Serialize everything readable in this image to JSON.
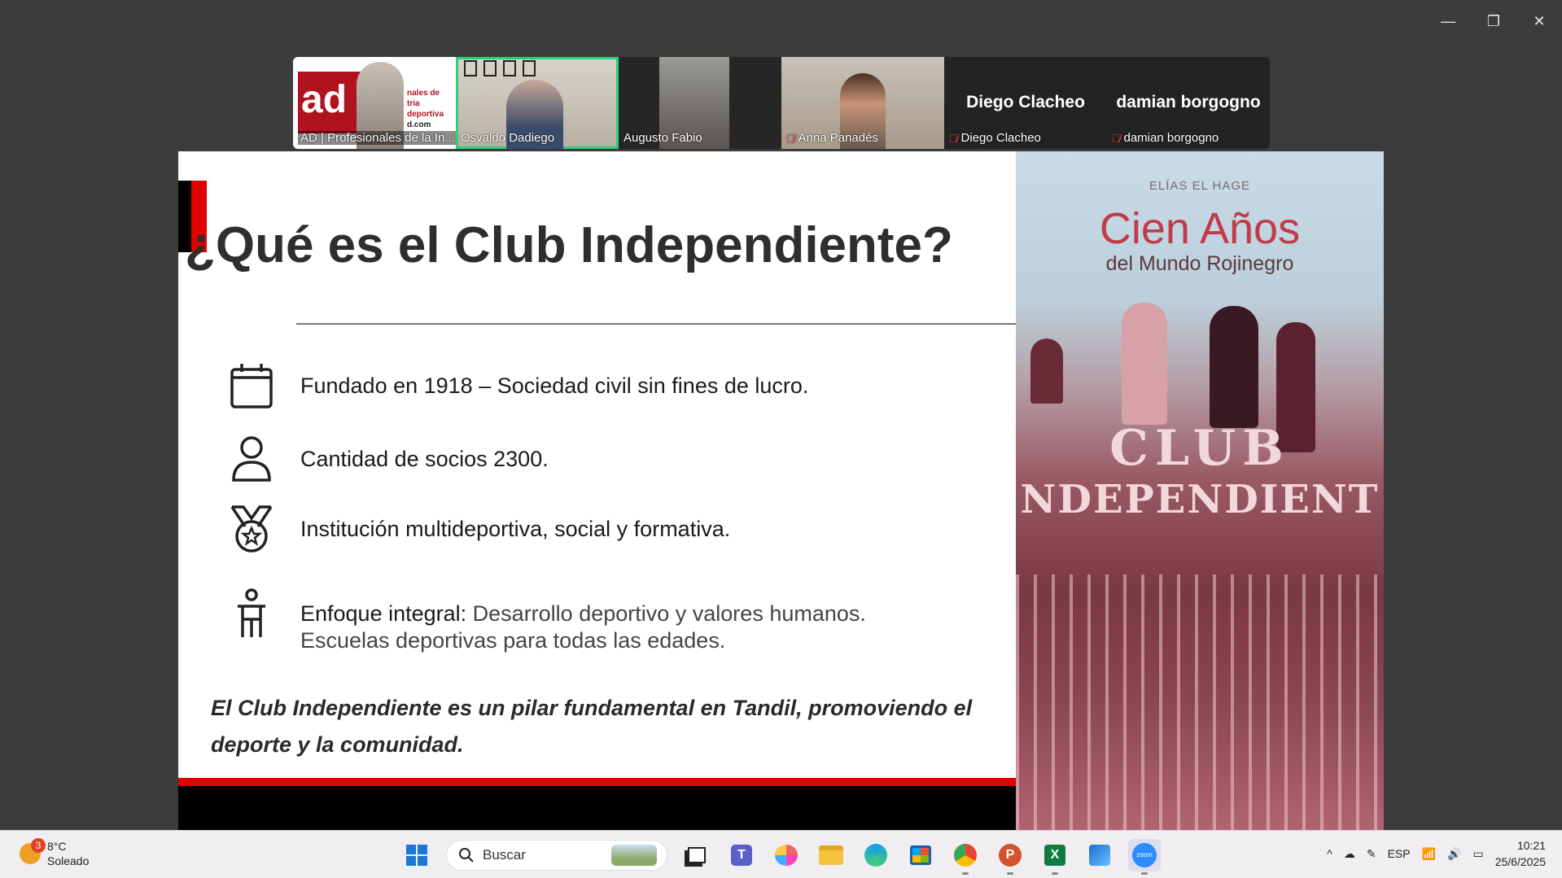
{
  "window": {
    "minimize": "—",
    "restore": "❐",
    "close": "✕"
  },
  "participants": [
    {
      "name": "AD | Profesionales de la In...",
      "logo": "ad",
      "video_text": [
        "nales de",
        "tria deportiva",
        "d.com"
      ],
      "muted": false,
      "active": false
    },
    {
      "name": "Osvaldo Dadiego",
      "muted": false,
      "active": true
    },
    {
      "name": "Augusto Fabio",
      "muted": false,
      "active": false
    },
    {
      "name": "Anna Panadés",
      "muted": true,
      "active": false
    },
    {
      "name": "Diego Clacheo",
      "display": "Diego Clacheo",
      "muted": true,
      "active": false
    },
    {
      "name": "damian borgogno",
      "display": "damian borgogno",
      "muted": true,
      "active": false
    }
  ],
  "slide": {
    "title": "¿Qué es el Club Independiente?",
    "items": [
      {
        "icon": "calendar-icon",
        "text": "Fundado en 1918 – Sociedad civil sin fines de lucro."
      },
      {
        "icon": "person-icon",
        "text": "Cantidad de socios 2300."
      },
      {
        "icon": "medal-icon",
        "text": "Institución multideportiva, social y formativa."
      },
      {
        "icon": "figure-icon",
        "label": "Enfoque integral:",
        "text": " Desarrollo deportivo y valores humanos.",
        "text2": "Escuelas deportivas para todas las edades."
      }
    ],
    "quote": "El Club Independiente es un pilar fundamental en Tandil, promoviendo el deporte y la comunidad."
  },
  "book": {
    "author": "ELÍAS EL HAGE",
    "title1": "Cien Años",
    "title2": "del Mundo Rojinegro",
    "sign1": "CLUB",
    "sign2": "NDEPENDIENT"
  },
  "taskbar": {
    "weather_temp": "8°C",
    "weather_desc": "Soleado",
    "weather_badge": "3",
    "search_placeholder": "Buscar",
    "lang": "ESP",
    "time": "10:21",
    "date": "25/6/2025"
  },
  "colors": {
    "accent_red": "#e00000",
    "active_speaker": "#2bd17a"
  }
}
